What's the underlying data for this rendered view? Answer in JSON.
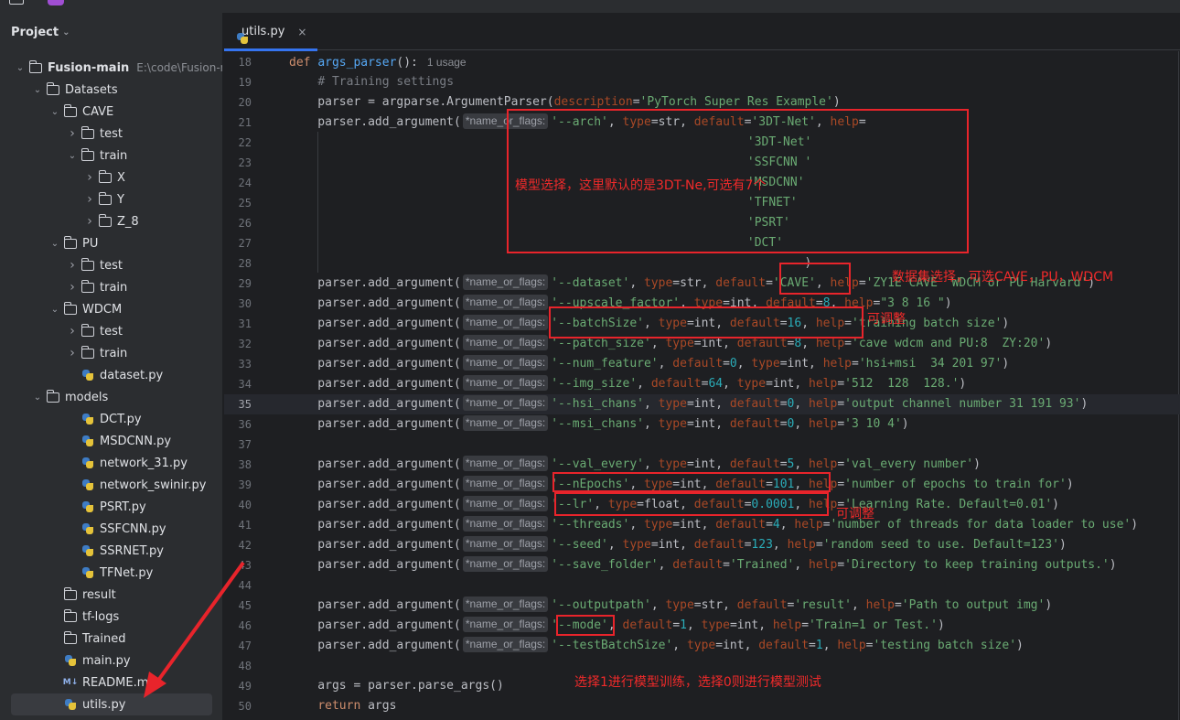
{
  "project": {
    "title": "Project"
  },
  "tree": [
    {
      "label": "Fusion-main",
      "sub": "E:\\code\\Fusion-ma",
      "type": "folder",
      "depth": 0,
      "expanded": true,
      "bold": true
    },
    {
      "label": "Datasets",
      "type": "folder",
      "depth": 1,
      "expanded": true
    },
    {
      "label": "CAVE",
      "type": "folder",
      "depth": 2,
      "expanded": true
    },
    {
      "label": "test",
      "type": "folder",
      "depth": 3,
      "expanded": false
    },
    {
      "label": "train",
      "type": "folder",
      "depth": 3,
      "expanded": true
    },
    {
      "label": "X",
      "type": "folder",
      "depth": 4,
      "expanded": false
    },
    {
      "label": "Y",
      "type": "folder",
      "depth": 4,
      "expanded": false
    },
    {
      "label": "Z_8",
      "type": "folder",
      "depth": 4,
      "expanded": false
    },
    {
      "label": "PU",
      "type": "folder",
      "depth": 2,
      "expanded": true
    },
    {
      "label": "test",
      "type": "folder",
      "depth": 3,
      "expanded": false
    },
    {
      "label": "train",
      "type": "folder",
      "depth": 3,
      "expanded": false
    },
    {
      "label": "WDCM",
      "type": "folder",
      "depth": 2,
      "expanded": true
    },
    {
      "label": "test",
      "type": "folder",
      "depth": 3,
      "expanded": false
    },
    {
      "label": "train",
      "type": "folder",
      "depth": 3,
      "expanded": false
    },
    {
      "label": "dataset.py",
      "type": "py",
      "depth": 3
    },
    {
      "label": "models",
      "type": "folder",
      "depth": 1,
      "expanded": true
    },
    {
      "label": "DCT.py",
      "type": "py",
      "depth": 3
    },
    {
      "label": "MSDCNN.py",
      "type": "py",
      "depth": 3
    },
    {
      "label": "network_31.py",
      "type": "py",
      "depth": 3
    },
    {
      "label": "network_swinir.py",
      "type": "py",
      "depth": 3
    },
    {
      "label": "PSRT.py",
      "type": "py",
      "depth": 3
    },
    {
      "label": "SSFCNN.py",
      "type": "py",
      "depth": 3
    },
    {
      "label": "SSRNET.py",
      "type": "py",
      "depth": 3
    },
    {
      "label": "TFNet.py",
      "type": "py",
      "depth": 3
    },
    {
      "label": "result",
      "type": "folder",
      "depth": 2,
      "noarrow": true
    },
    {
      "label": "tf-logs",
      "type": "folder",
      "depth": 2,
      "noarrow": true
    },
    {
      "label": "Trained",
      "type": "folder",
      "depth": 2,
      "noarrow": true
    },
    {
      "label": "main.py",
      "type": "py",
      "depth": 2
    },
    {
      "label": "README.md",
      "type": "md",
      "icon_text": "M↓",
      "depth": 2
    },
    {
      "label": "utils.py",
      "type": "py",
      "depth": 2,
      "selected": true
    }
  ],
  "tab": {
    "label": "utils.py",
    "close": "×"
  },
  "editor": {
    "usage_hint": "1 usage",
    "inlay_hint": "*name_or_flags:",
    "current_line": 35,
    "lines": [
      {
        "n": "18",
        "html": "<span class='k'>def</span> <span class='f'>args_parser</span>():<span class='usage'>1 usage</span>",
        "x0": true
      },
      {
        "n": "19",
        "html": "    <span class='c'># Training settings</span>"
      },
      {
        "n": "20",
        "html": "    parser = argparse.ArgumentParser(<span class='p'>description</span>=<span class='s'>'PyTorch Super Res Example'</span>)"
      },
      {
        "n": "21",
        "html": "    parser.add_argument(<span class='hint'>*name_or_flags:</span><span class='s'>'--arch'</span>, <span class='p'>type</span>=str, <span class='p'>default</span>=<span class='s'>'3DT-Net'</span>, <span class='p'>help</span>="
      },
      {
        "n": "22",
        "html": "                                                                <span class='s'>'3DT-Net'</span>"
      },
      {
        "n": "23",
        "html": "                                                                <span class='s'>'SSFCNN '</span>"
      },
      {
        "n": "24",
        "html": "                                                                <span class='s'>'MSDCNN'</span>"
      },
      {
        "n": "25",
        "html": "                                                                <span class='s'>'TFNET'</span>"
      },
      {
        "n": "26",
        "html": "                                                                <span class='s'>'PSRT'</span>"
      },
      {
        "n": "27",
        "html": "                                                                <span class='s'>'DCT'</span>"
      },
      {
        "n": "28",
        "html": "                                                                        )"
      },
      {
        "n": "29",
        "html": "    parser.add_argument(<span class='hint'>*name_or_flags:</span><span class='s'>'--dataset'</span>, <span class='p'>type</span>=str, <span class='p'>default</span>=<span class='s'>'CAVE'</span>, <span class='p'>help</span>=<span class='s'>'ZY1E CAVE  WDCM or PU Harvard'</span>)"
      },
      {
        "n": "30",
        "html": "    parser.add_argument(<span class='hint'>*name_or_flags:</span><span class='s'>'--upscale_factor'</span>, <span class='p'>type</span>=int, <span class='p'>default</span>=<span class='n'>8</span>, <span class='p'>help</span>=<span class='s'>\"3 8 16 \"</span>)"
      },
      {
        "n": "31",
        "html": "    parser.add_argument(<span class='hint'>*name_or_flags:</span><span class='s'>'--batchSize'</span>, <span class='p'>type</span>=int, <span class='p'>default</span>=<span class='n'>16</span>, <span class='p'>help</span>=<span class='s'>'training batch size'</span>)"
      },
      {
        "n": "32",
        "html": "    parser.add_argument(<span class='hint'>*name_or_flags:</span><span class='s'>'--patch_size'</span>, <span class='p'>type</span>=int, <span class='p'>default</span>=<span class='n'>8</span>, <span class='p'>help</span>=<span class='s'>'cave wdcm and PU:8  ZY:20'</span>)"
      },
      {
        "n": "33",
        "html": "    parser.add_argument(<span class='hint'>*name_or_flags:</span><span class='s'>'--num_feature'</span>, <span class='p'>default</span>=<span class='n'>0</span>, <span class='p'>type</span>=int, <span class='p'>help</span>=<span class='s'>'hsi+msi  34 201 97'</span>)"
      },
      {
        "n": "34",
        "html": "    parser.add_argument(<span class='hint'>*name_or_flags:</span><span class='s'>'--img_size'</span>, <span class='p'>default</span>=<span class='n'>64</span>, <span class='p'>type</span>=int, <span class='p'>help</span>=<span class='s'>'512  128  128.'</span>)"
      },
      {
        "n": "35",
        "html": "    parser.add_argument(<span class='hint'>*name_or_flags:</span><span class='s'>'--hsi_chans'</span>, <span class='p'>type</span>=int, <span class='p'>default</span>=<span class='n'>0</span>, <span class='p'>help</span>=<span class='s'>'output channel number 31 191 93'</span>)"
      },
      {
        "n": "36",
        "html": "    parser.add_argument(<span class='hint'>*name_or_flags:</span><span class='s'>'--msi_chans'</span>, <span class='p'>type</span>=int, <span class='p'>default</span>=<span class='n'>0</span>, <span class='p'>help</span>=<span class='s'>'3 10 4'</span>)"
      },
      {
        "n": "37",
        "html": ""
      },
      {
        "n": "38",
        "html": "    parser.add_argument(<span class='hint'>*name_or_flags:</span><span class='s'>'--val_every'</span>, <span class='p'>type</span>=int, <span class='p'>default</span>=<span class='n'>5</span>, <span class='p'>help</span>=<span class='s'>'val_every number'</span>)"
      },
      {
        "n": "39",
        "html": "    parser.add_argument(<span class='hint'>*name_or_flags:</span><span class='s'>'--nEpochs'</span>, <span class='p'>type</span>=int, <span class='p'>default</span>=<span class='n'>101</span>, <span class='p'>help</span>=<span class='s'>'number of epochs to train for'</span>)"
      },
      {
        "n": "40",
        "html": "    parser.add_argument(<span class='hint'>*name_or_flags:</span><span class='s'>'--lr'</span>, <span class='p'>type</span>=float, <span class='p'>default</span>=<span class='n'>0.0001</span>, <span class='p'>help</span>=<span class='s'>'Learning Rate. Default=0.01'</span>)"
      },
      {
        "n": "41",
        "html": "    parser.add_argument(<span class='hint'>*name_or_flags:</span><span class='s'>'--threads'</span>, <span class='p'>type</span>=int, <span class='p'>default</span>=<span class='n'>4</span>, <span class='p'>help</span>=<span class='s'>'number of threads for data loader to use'</span>)"
      },
      {
        "n": "42",
        "html": "    parser.add_argument(<span class='hint'>*name_or_flags:</span><span class='s'>'--seed'</span>, <span class='p'>type</span>=int, <span class='p'>default</span>=<span class='n'>123</span>, <span class='p'>help</span>=<span class='s'>'random seed to use. Default=123'</span>)"
      },
      {
        "n": "43",
        "html": "    parser.add_argument(<span class='hint'>*name_or_flags:</span><span class='s'>'--save_folder'</span>, <span class='p'>default</span>=<span class='s'>'Trained'</span>, <span class='p'>help</span>=<span class='s'>'Directory to keep training outputs.'</span>)"
      },
      {
        "n": "44",
        "html": ""
      },
      {
        "n": "45",
        "html": "    parser.add_argument(<span class='hint'>*name_or_flags:</span><span class='s'>'--outputpath'</span>, <span class='p'>type</span>=str, <span class='p'>default</span>=<span class='s'>'result'</span>, <span class='p'>help</span>=<span class='s'>'Path to output img'</span>)"
      },
      {
        "n": "46",
        "html": "    parser.add_argument(<span class='hint'>*name_or_flags:</span><span class='s'>'--mode'</span>, <span class='p'>default</span>=<span class='n'>1</span>, <span class='p'>type</span>=int, <span class='p'>help</span>=<span class='s'>'Train=1 or Test.'</span>)"
      },
      {
        "n": "47",
        "html": "    parser.add_argument(<span class='hint'>*name_or_flags:</span><span class='s'>'--testBatchSize'</span>, <span class='p'>type</span>=int, <span class='p'>default</span>=<span class='n'>1</span>, <span class='p'>help</span>=<span class='s'>'testing batch size'</span>)"
      },
      {
        "n": "48",
        "html": ""
      },
      {
        "n": "49",
        "html": "    args = parser.parse_args()"
      },
      {
        "n": "50",
        "html": "    <span class='k'>return</span> args"
      }
    ]
  },
  "annotations": {
    "model_note": "模型选择，这里默认的是3DT-Ne,可选有7个",
    "dataset_note": "数据集选择，可选CAVE，PU，WDCM",
    "adjust_note_1": "可调整",
    "adjust_note_2": "可调整",
    "mode_note": "选择1进行模型训练，选择0则进行模型测试",
    "color": "#e8242b"
  }
}
